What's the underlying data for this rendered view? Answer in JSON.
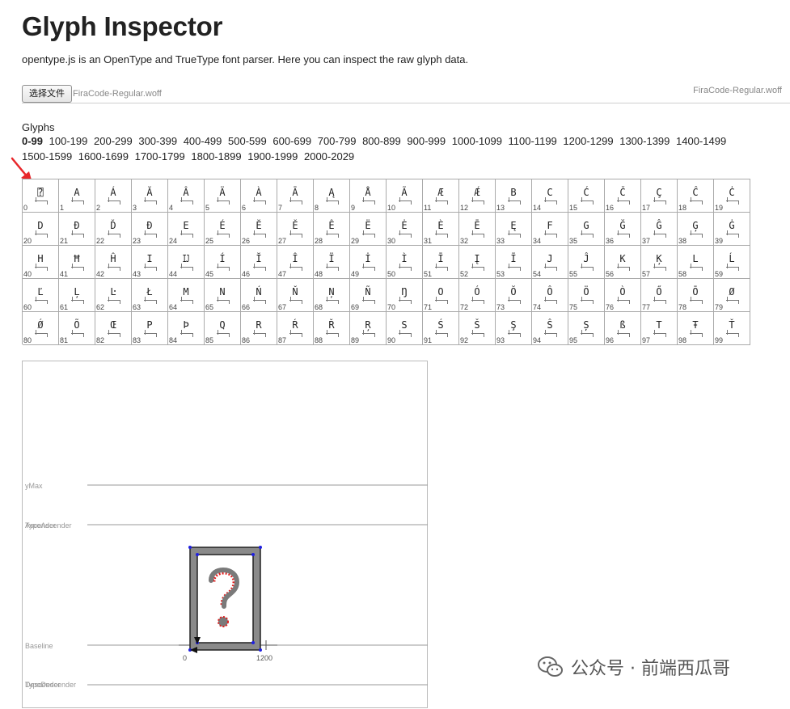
{
  "page": {
    "title": "Glyph Inspector",
    "intro": "opentype.js is an OpenType and TrueType font parser. Here you can inspect the raw glyph data."
  },
  "file_input": {
    "button_label": "选择文件",
    "file_name": "FiraCode-Regular.woff",
    "loaded_font": "FiraCode-Regular.woff"
  },
  "glyphs": {
    "heading": "Glyphs",
    "ranges": [
      "0-99",
      "100-199",
      "200-299",
      "300-399",
      "400-499",
      "500-599",
      "600-699",
      "700-799",
      "800-899",
      "900-999",
      "1000-1099",
      "1100-1199",
      "1200-1299",
      "1300-1399",
      "1400-1499",
      "1500-1599",
      "1600-1699",
      "1700-1799",
      "1800-1899",
      "1900-1999",
      "2000-2029"
    ],
    "active_range": "0-99",
    "selected_index": 0,
    "cells": [
      {
        "i": "0",
        "c": "⍰"
      },
      {
        "i": "1",
        "c": "A"
      },
      {
        "i": "2",
        "c": "Á"
      },
      {
        "i": "3",
        "c": "Ă"
      },
      {
        "i": "4",
        "c": "Â"
      },
      {
        "i": "5",
        "c": "Ä"
      },
      {
        "i": "6",
        "c": "À"
      },
      {
        "i": "7",
        "c": "Ā"
      },
      {
        "i": "8",
        "c": "Ą"
      },
      {
        "i": "9",
        "c": "Å"
      },
      {
        "i": "10",
        "c": "Ã"
      },
      {
        "i": "11",
        "c": "Æ"
      },
      {
        "i": "12",
        "c": "Ǽ"
      },
      {
        "i": "13",
        "c": "B"
      },
      {
        "i": "14",
        "c": "C"
      },
      {
        "i": "15",
        "c": "Ć"
      },
      {
        "i": "16",
        "c": "Č"
      },
      {
        "i": "17",
        "c": "Ç"
      },
      {
        "i": "18",
        "c": "Ĉ"
      },
      {
        "i": "19",
        "c": "Ċ"
      },
      {
        "i": "20",
        "c": "D"
      },
      {
        "i": "21",
        "c": "Ð"
      },
      {
        "i": "22",
        "c": "Ď"
      },
      {
        "i": "23",
        "c": "Đ"
      },
      {
        "i": "24",
        "c": "E"
      },
      {
        "i": "25",
        "c": "É"
      },
      {
        "i": "26",
        "c": "Ĕ"
      },
      {
        "i": "27",
        "c": "Ě"
      },
      {
        "i": "28",
        "c": "Ê"
      },
      {
        "i": "29",
        "c": "Ë"
      },
      {
        "i": "30",
        "c": "Ė"
      },
      {
        "i": "31",
        "c": "È"
      },
      {
        "i": "32",
        "c": "Ē"
      },
      {
        "i": "33",
        "c": "Ę"
      },
      {
        "i": "34",
        "c": "F"
      },
      {
        "i": "35",
        "c": "G"
      },
      {
        "i": "36",
        "c": "Ğ"
      },
      {
        "i": "37",
        "c": "Ĝ"
      },
      {
        "i": "38",
        "c": "Ģ"
      },
      {
        "i": "39",
        "c": "Ġ"
      },
      {
        "i": "40",
        "c": "H"
      },
      {
        "i": "41",
        "c": "Ħ"
      },
      {
        "i": "42",
        "c": "Ĥ"
      },
      {
        "i": "43",
        "c": "I"
      },
      {
        "i": "44",
        "c": "Ĳ"
      },
      {
        "i": "45",
        "c": "Í"
      },
      {
        "i": "46",
        "c": "Ĭ"
      },
      {
        "i": "47",
        "c": "Î"
      },
      {
        "i": "48",
        "c": "Ï"
      },
      {
        "i": "49",
        "c": "İ"
      },
      {
        "i": "50",
        "c": "Ì"
      },
      {
        "i": "51",
        "c": "Ī"
      },
      {
        "i": "52",
        "c": "Į"
      },
      {
        "i": "53",
        "c": "Ĩ"
      },
      {
        "i": "54",
        "c": "J"
      },
      {
        "i": "55",
        "c": "Ĵ"
      },
      {
        "i": "56",
        "c": "K"
      },
      {
        "i": "57",
        "c": "Ķ"
      },
      {
        "i": "58",
        "c": "L"
      },
      {
        "i": "59",
        "c": "Ĺ"
      },
      {
        "i": "60",
        "c": "Ľ"
      },
      {
        "i": "61",
        "c": "Ļ"
      },
      {
        "i": "62",
        "c": "Ŀ"
      },
      {
        "i": "63",
        "c": "Ł"
      },
      {
        "i": "64",
        "c": "M"
      },
      {
        "i": "65",
        "c": "N"
      },
      {
        "i": "66",
        "c": "Ń"
      },
      {
        "i": "67",
        "c": "Ň"
      },
      {
        "i": "68",
        "c": "Ņ"
      },
      {
        "i": "69",
        "c": "Ñ"
      },
      {
        "i": "70",
        "c": "Ŋ"
      },
      {
        "i": "71",
        "c": "O"
      },
      {
        "i": "72",
        "c": "Ó"
      },
      {
        "i": "73",
        "c": "Ŏ"
      },
      {
        "i": "74",
        "c": "Ô"
      },
      {
        "i": "75",
        "c": "Ö"
      },
      {
        "i": "76",
        "c": "Ò"
      },
      {
        "i": "77",
        "c": "Ő"
      },
      {
        "i": "78",
        "c": "Ō"
      },
      {
        "i": "79",
        "c": "Ø"
      },
      {
        "i": "80",
        "c": "Ǿ"
      },
      {
        "i": "81",
        "c": "Õ"
      },
      {
        "i": "82",
        "c": "Œ"
      },
      {
        "i": "83",
        "c": "P"
      },
      {
        "i": "84",
        "c": "Þ"
      },
      {
        "i": "85",
        "c": "Q"
      },
      {
        "i": "86",
        "c": "R"
      },
      {
        "i": "87",
        "c": "Ŕ"
      },
      {
        "i": "88",
        "c": "Ř"
      },
      {
        "i": "89",
        "c": "Ŗ"
      },
      {
        "i": "90",
        "c": "S"
      },
      {
        "i": "91",
        "c": "Ś"
      },
      {
        "i": "92",
        "c": "Š"
      },
      {
        "i": "93",
        "c": "Ş"
      },
      {
        "i": "94",
        "c": "Ŝ"
      },
      {
        "i": "95",
        "c": "Ș"
      },
      {
        "i": "96",
        "c": "ß"
      },
      {
        "i": "97",
        "c": "T"
      },
      {
        "i": "98",
        "c": "Ŧ"
      },
      {
        "i": "99",
        "c": "Ť"
      }
    ]
  },
  "inspector": {
    "metric_labels": {
      "ymax": "yMax",
      "ascender": "Ascender",
      "typo_ascender": "TypoAscender",
      "baseline": "Baseline",
      "descender": "Descender",
      "typo_descender": "TypoDescender"
    },
    "x_axis": {
      "origin": "0",
      "advance": "1200"
    },
    "colors": {
      "outline_fill": "#8a8a8a",
      "on_curve_point": "#2020e0",
      "off_curve_point": "#e02020",
      "metric_line": "#999999"
    }
  },
  "annotation": {
    "arrow_color": "#e8262a"
  },
  "watermark": {
    "text": "公众号 · 前端西瓜哥",
    "icon": "wechat-icon"
  }
}
